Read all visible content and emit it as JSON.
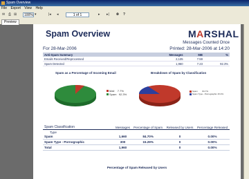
{
  "window": {
    "title": "Spam Overview"
  },
  "menu": [
    "File",
    "Export",
    "View",
    "Help"
  ],
  "toolbar": {
    "zoom": "100%",
    "page": "1 of 1",
    "first": "|◂",
    "prev": "◂",
    "next": "▸",
    "last": "▸|"
  },
  "tabs": [
    "Preview"
  ],
  "report": {
    "title": "Spam Overview",
    "logo_main": "M",
    "logo_accent": "A",
    "logo_rest": "RSHAL",
    "counted": "Messages Counted Once",
    "date_left": "For 28-Mar-2006",
    "date_right": "Printed: 28-Mar-2006 at 14:20",
    "summary": {
      "headers": [
        "Anti-Spam Summary",
        "Messages",
        "MB",
        "%"
      ],
      "rows": [
        [
          "Emails Received/Reprocessed",
          "2,135",
          "7.59",
          ""
        ],
        [
          "Spam Detected",
          "1,960",
          "7.23",
          "92.3%"
        ]
      ]
    },
    "chart1_title": "Spam as a Percentage of Incoming Email",
    "chart2_title": "Breakdown of Spam by Classification",
    "pie1_legend": [
      {
        "label": "Mail",
        "value": "7.7%",
        "color": "#c0392b"
      },
      {
        "label": "Spam",
        "value": "92.3%",
        "color": "#2e8b3c"
      }
    ],
    "pie2_legend": [
      {
        "label": "Spam",
        "value": "84.7%",
        "color": "#c0392b"
      },
      {
        "label": "Spam Type - Pornographic",
        "value": "15.3%",
        "color": "#2d3f9e"
      }
    ],
    "classification": {
      "headers": [
        "Spam Classification",
        "Messages",
        "Percentage of Spam",
        "Released by Users",
        "Percentage Released"
      ],
      "subheader": "Type",
      "rows": [
        [
          "Spam",
          "1,660",
          "84.70%",
          "0",
          "0.00%"
        ],
        [
          "Spam Type - Pornographic",
          "300",
          "15.29%",
          "0",
          "0.00%"
        ],
        [
          "Total",
          "1,960",
          "",
          "0",
          "0.00%"
        ]
      ]
    },
    "bottom_title": "Percentage of Spam Released by Users"
  }
}
